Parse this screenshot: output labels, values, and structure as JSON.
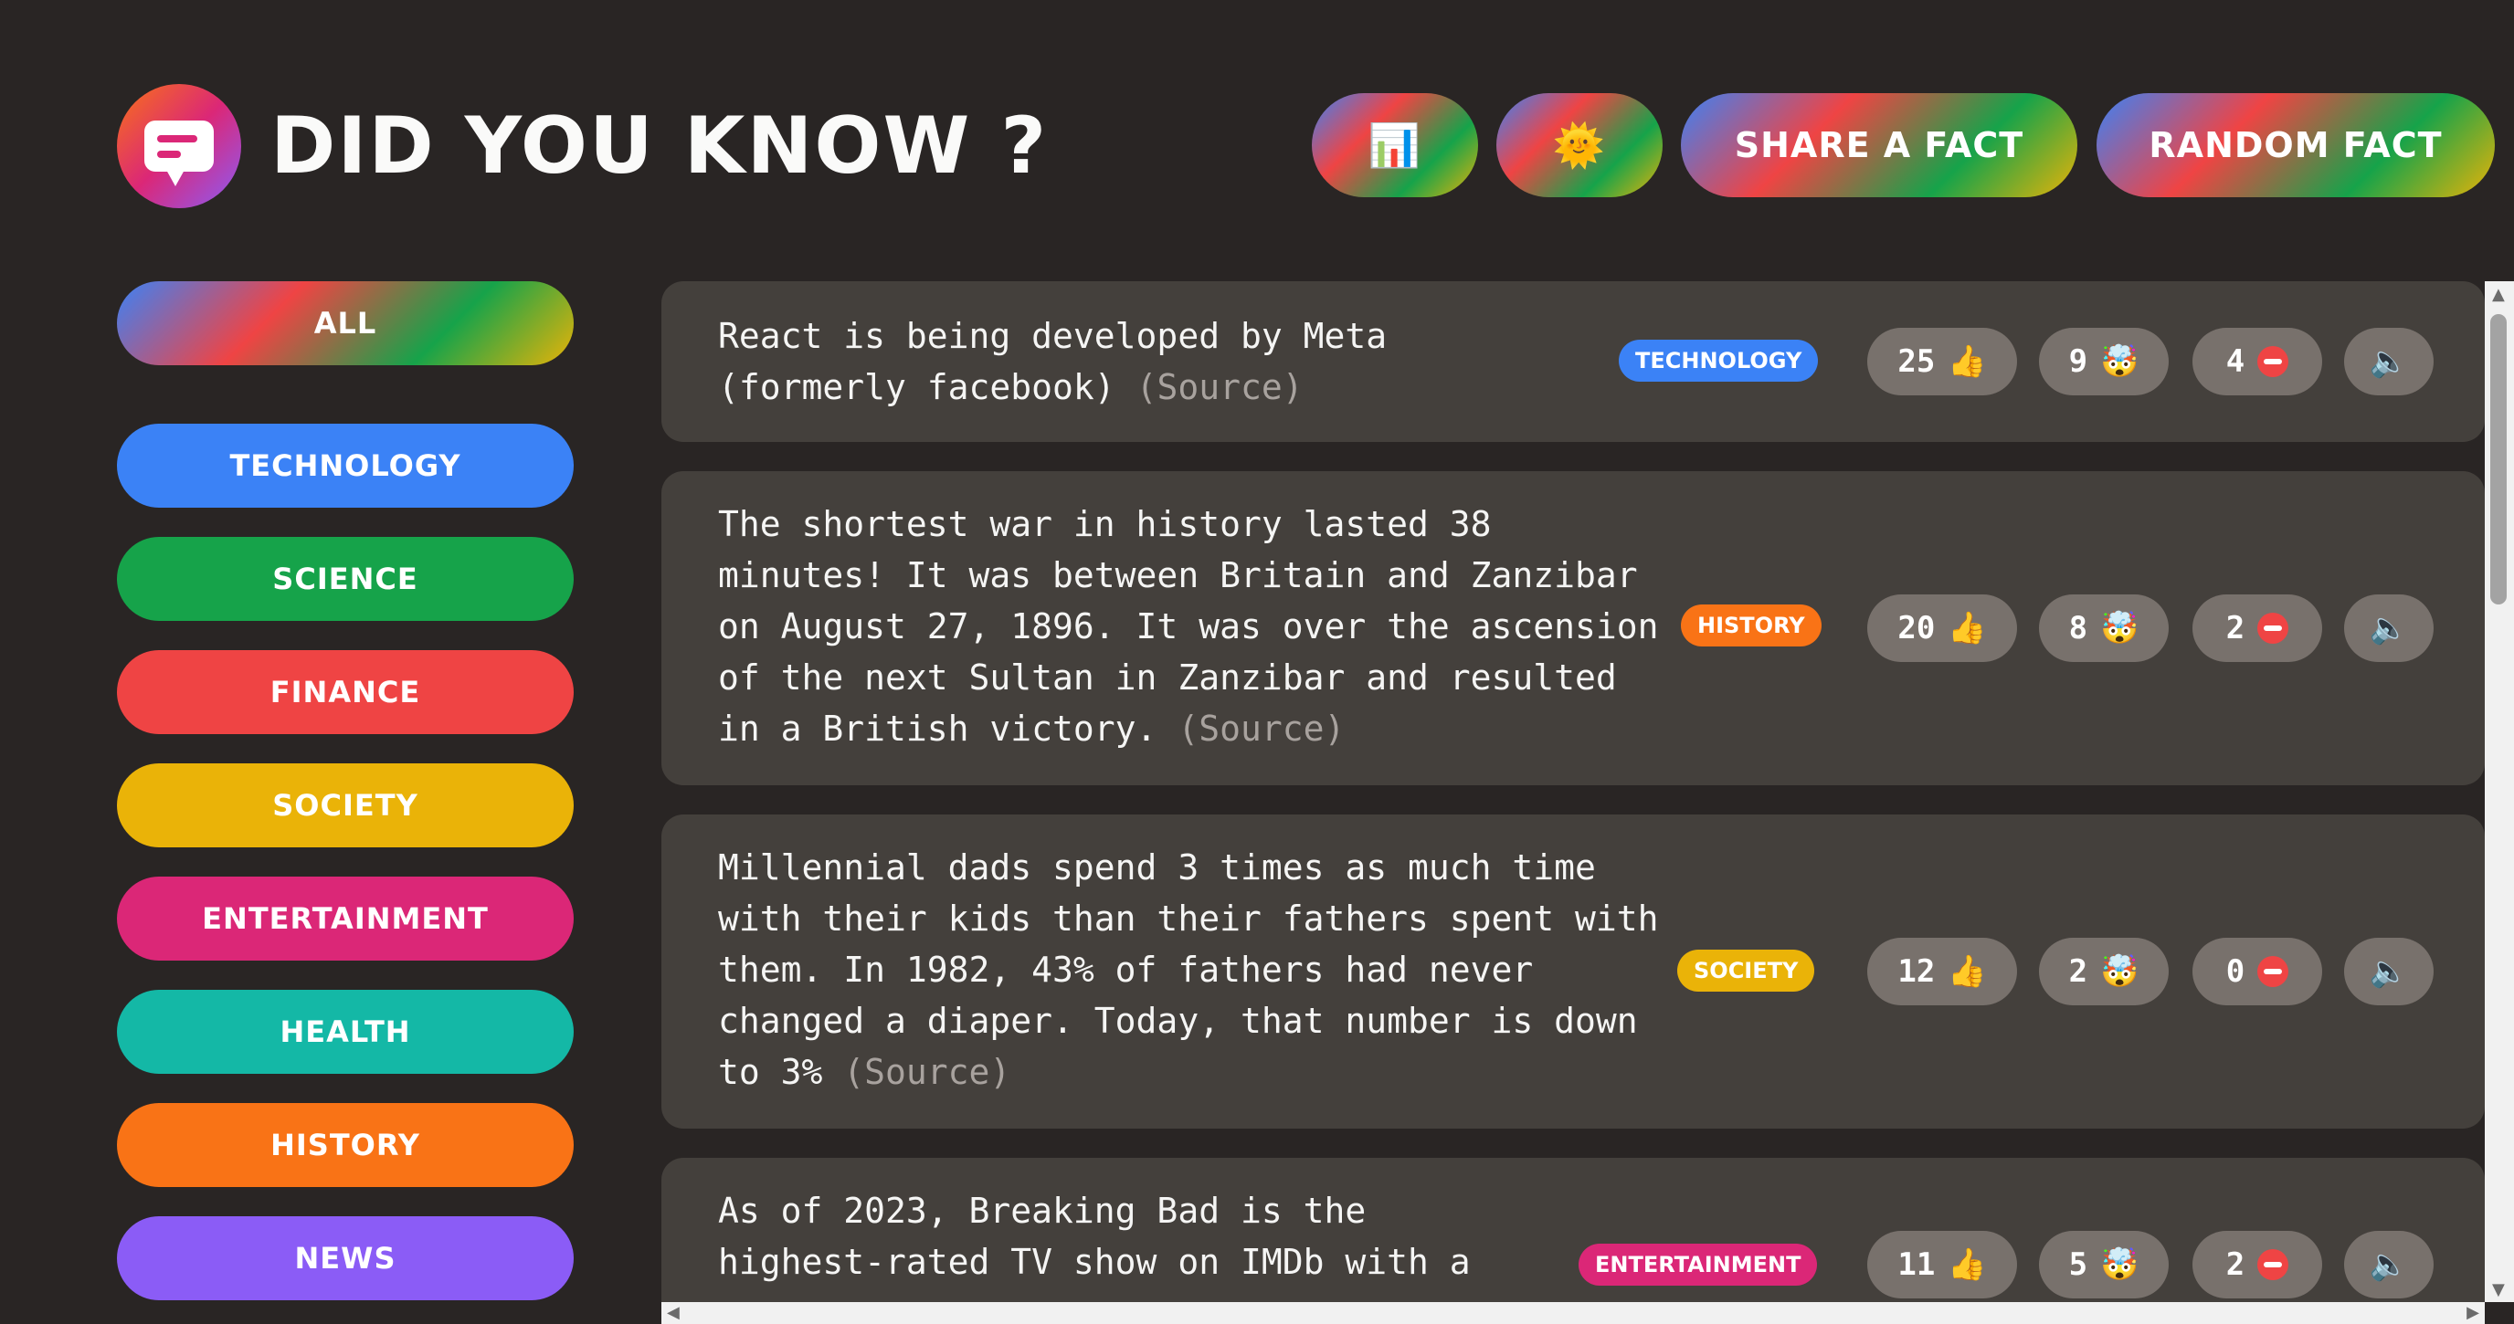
{
  "header": {
    "title": "DID YOU KNOW ?",
    "stats_icon": "📊",
    "theme_icon": "🌞",
    "share_label": "SHARE A FACT",
    "random_label": "RANDOM FACT"
  },
  "categories": [
    {
      "label": "ALL",
      "color": "gradient"
    },
    {
      "label": "TECHNOLOGY",
      "color": "#3b82f6"
    },
    {
      "label": "SCIENCE",
      "color": "#16a34a"
    },
    {
      "label": "FINANCE",
      "color": "#ef4444"
    },
    {
      "label": "SOCIETY",
      "color": "#eab308"
    },
    {
      "label": "ENTERTAINMENT",
      "color": "#db2777"
    },
    {
      "label": "HEALTH",
      "color": "#14b8a6"
    },
    {
      "label": "HISTORY",
      "color": "#f97316"
    },
    {
      "label": "NEWS",
      "color": "#8b5cf6"
    }
  ],
  "facts": [
    {
      "text": "React is being developed by Meta (formerly facebook)",
      "source": "(Source)",
      "category": "TECHNOLOGY",
      "category_color": "#3b82f6",
      "interesting": 25,
      "mindblowing": 9,
      "false": 4
    },
    {
      "text": "The shortest war in history lasted 38 minutes! It was between Britain and Zanzibar on August 27, 1896. It was over the ascension of the next Sultan in Zanzibar and resulted in a British victory.",
      "source": "(Source)",
      "category": "HISTORY",
      "category_color": "#f97316",
      "interesting": 20,
      "mindblowing": 8,
      "false": 2
    },
    {
      "text": "Millennial dads spend 3 times as much time with their kids than their fathers spent with them. In 1982, 43% of fathers had never changed a diaper. Today, that number is down to 3%",
      "source": "(Source)",
      "category": "SOCIETY",
      "category_color": "#eab308",
      "interesting": 12,
      "mindblowing": 2,
      "false": 0
    },
    {
      "text": "As of 2023, Breaking Bad is the highest-rated TV show on IMDb with a",
      "source": "",
      "category": "ENTERTAINMENT",
      "category_color": "#db2777",
      "interesting": 11,
      "mindblowing": 5,
      "false": 2
    }
  ],
  "icons": {
    "thumbs_up": "👍",
    "mindblowing": "🤯",
    "minus": "minus-circle-icon",
    "speaker": "🔈"
  }
}
